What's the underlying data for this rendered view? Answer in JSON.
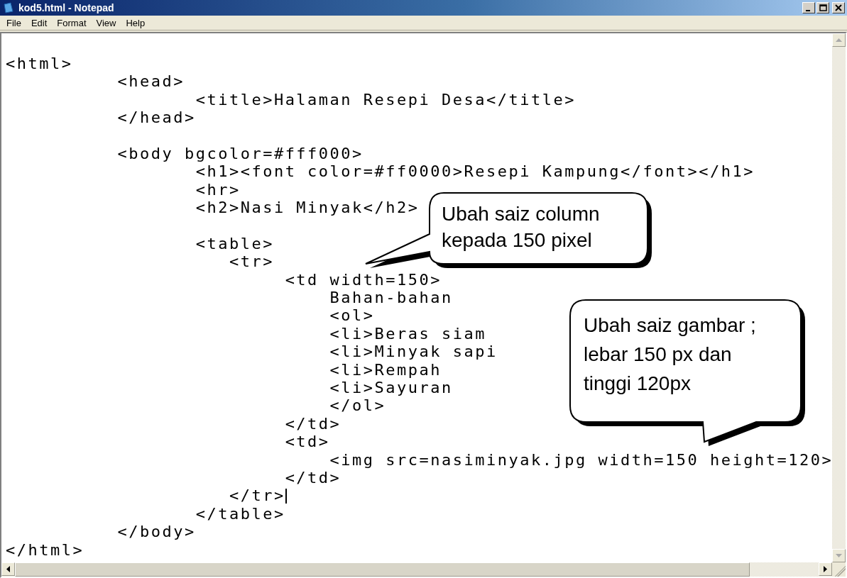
{
  "window": {
    "title": "kod5.html - Notepad"
  },
  "menu": [
    {
      "label": "File"
    },
    {
      "label": "Edit"
    },
    {
      "label": "Format"
    },
    {
      "label": "View"
    },
    {
      "label": "Help"
    }
  ],
  "editor": {
    "lines": [
      {
        "text": "<html>",
        "caret": false
      },
      {
        "text": "          <head>",
        "caret": false
      },
      {
        "text": "                 <title>Halaman Resepi Desa</title>",
        "caret": false
      },
      {
        "text": "          </head>",
        "caret": false
      },
      {
        "caret": false
      },
      {
        "text": "          <body bgcolor=#fff000>",
        "caret": false
      },
      {
        "text": "                 <h1><font color=#ff0000>Resepi Kampung</font></h1>",
        "caret": false
      },
      {
        "text": "                 <hr>",
        "caret": false
      },
      {
        "text": "                 <h2>Nasi Minyak</h2>",
        "caret": false
      },
      {
        "caret": false
      },
      {
        "text": "                 <table>",
        "caret": false
      },
      {
        "text": "                    <tr>",
        "caret": false
      },
      {
        "text": "                         <td width=150>",
        "caret": false
      },
      {
        "text": "                             Bahan-bahan",
        "caret": false
      },
      {
        "text": "                             <ol>",
        "caret": false
      },
      {
        "text": "                             <li>Beras siam",
        "caret": false
      },
      {
        "text": "                             <li>Minyak sapi",
        "caret": false
      },
      {
        "text": "                             <li>Rempah",
        "caret": false
      },
      {
        "text": "                             <li>Sayuran",
        "caret": false
      },
      {
        "text": "                             </ol>",
        "caret": false
      },
      {
        "text": "                         </td>",
        "caret": false
      },
      {
        "text": "                         <td>",
        "caret": false
      },
      {
        "text": "                             <img src=nasiminyak.jpg width=150 height=120>",
        "caret": false
      },
      {
        "text": "                         </td>",
        "caret": false
      },
      {
        "text": "                    </tr>",
        "caret": true
      },
      {
        "text": "                 </table>",
        "caret": false
      },
      {
        "text": "          </body>",
        "caret": false
      },
      {
        "text": "</html>",
        "caret": false
      }
    ]
  },
  "callouts": [
    {
      "lines": [
        "Ubah saiz column",
        "kepada 150 pixel"
      ]
    },
    {
      "lines": [
        "Ubah saiz gambar ;",
        "lebar 150 px dan",
        "tinggi 120px"
      ]
    }
  ]
}
